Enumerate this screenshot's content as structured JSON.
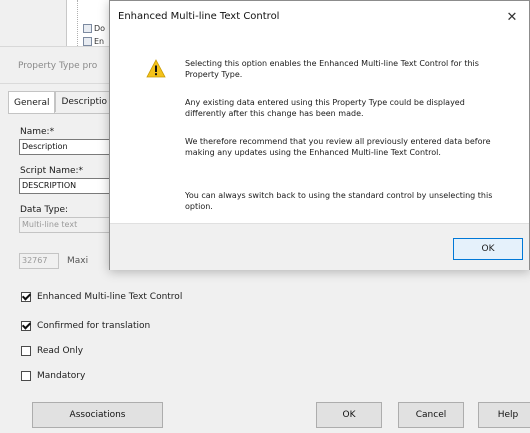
{
  "tree": {
    "items": [
      "Do",
      "En"
    ]
  },
  "property_window": {
    "title": "Property Type pro",
    "tabs": [
      "General",
      "Descriptio"
    ],
    "name_label": "Name:*",
    "name_value": "Description",
    "script_name_label": "Script Name:*",
    "script_name_value": "DESCRIPTION",
    "data_type_label": "Data Type:",
    "data_type_value": "Multi-line text",
    "max_length_value": "32767",
    "max_length_label": "Maxi",
    "checkboxes": [
      {
        "label": "Enhanced Multi-line Text Control",
        "checked": true
      },
      {
        "label": "Confirmed for translation",
        "checked": true
      },
      {
        "label": "Read Only",
        "checked": false
      },
      {
        "label": "Mandatory",
        "checked": false
      }
    ],
    "buttons": {
      "associations": "Associations",
      "ok": "OK",
      "cancel": "Cancel",
      "help": "Help"
    }
  },
  "modal": {
    "title": "Enhanced Multi-line Text Control",
    "close_glyph": "✕",
    "icon": "warning-icon",
    "messages": [
      "Selecting this option enables the Enhanced Multi-line Text Control for this Property Type.",
      "Any existing data entered using this Property Type could be displayed differently after this change has been made.",
      "We therefore recommend that you review all previously entered data before making any updates using the Enhanced Multi-line Text Control.",
      "You can always switch back to using the standard control by unselecting this option."
    ],
    "ok_label": "OK"
  },
  "colors": {
    "warning_yellow": "#f4c21a",
    "accent_blue": "#0078d7"
  }
}
